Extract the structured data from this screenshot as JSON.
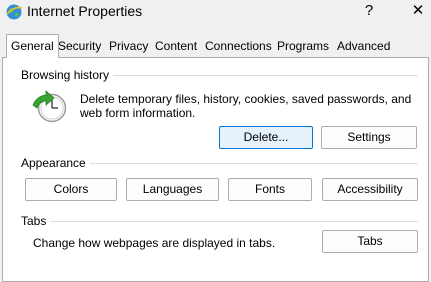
{
  "window": {
    "title": "Internet Properties",
    "help_glyph": "?",
    "close_glyph": "✕",
    "icons": {
      "app": "internet-globe-icon"
    }
  },
  "tabs": [
    {
      "label": "General",
      "active": true
    },
    {
      "label": "Security"
    },
    {
      "label": "Privacy"
    },
    {
      "label": "Content"
    },
    {
      "label": "Connections"
    },
    {
      "label": "Programs"
    },
    {
      "label": "Advanced"
    }
  ],
  "browsing_history": {
    "title": "Browsing history",
    "description_line1": "Delete temporary files, history, cookies, saved passwords, and",
    "description_line2": "web form information.",
    "icon": "history-clock-icon",
    "delete_label": "Delete...",
    "settings_label": "Settings"
  },
  "appearance": {
    "title": "Appearance",
    "buttons": [
      "Colors",
      "Languages",
      "Fonts",
      "Accessibility"
    ]
  },
  "tabs_group": {
    "title": "Tabs",
    "description": "Change how webpages are displayed in tabs.",
    "button_label": "Tabs"
  },
  "colors": {
    "accent": "#0078d7",
    "pane": "#ffffff",
    "chrome": "#f0f0f0",
    "icon_green": "#3aa335"
  }
}
